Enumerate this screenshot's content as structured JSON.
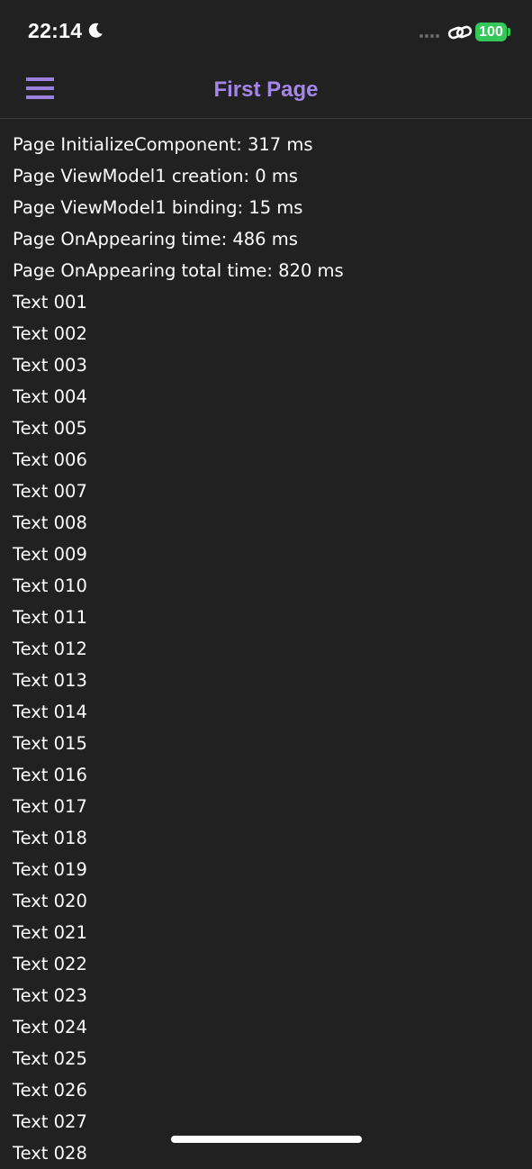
{
  "status_bar": {
    "time": "22:14",
    "battery_level": "100",
    "battery_color": "#34c759"
  },
  "nav": {
    "title": "First Page",
    "accent_color": "#a386e8",
    "menu_icon": "hamburger-menu-icon"
  },
  "timings": [
    "Page InitializeComponent: 317 ms",
    "Page ViewModel1 creation: 0 ms",
    "Page ViewModel1 binding: 15 ms",
    "Page OnAppearing time: 486 ms",
    "Page OnAppearing total time: 820 ms"
  ],
  "items": [
    "Text 001",
    "Text 002",
    "Text 003",
    "Text 004",
    "Text 005",
    "Text 006",
    "Text 007",
    "Text 008",
    "Text 009",
    "Text 010",
    "Text 011",
    "Text 012",
    "Text 013",
    "Text 014",
    "Text 015",
    "Text 016",
    "Text 017",
    "Text 018",
    "Text 019",
    "Text 020",
    "Text 021",
    "Text 022",
    "Text 023",
    "Text 024",
    "Text 025",
    "Text 026",
    "Text 027",
    "Text 028"
  ]
}
